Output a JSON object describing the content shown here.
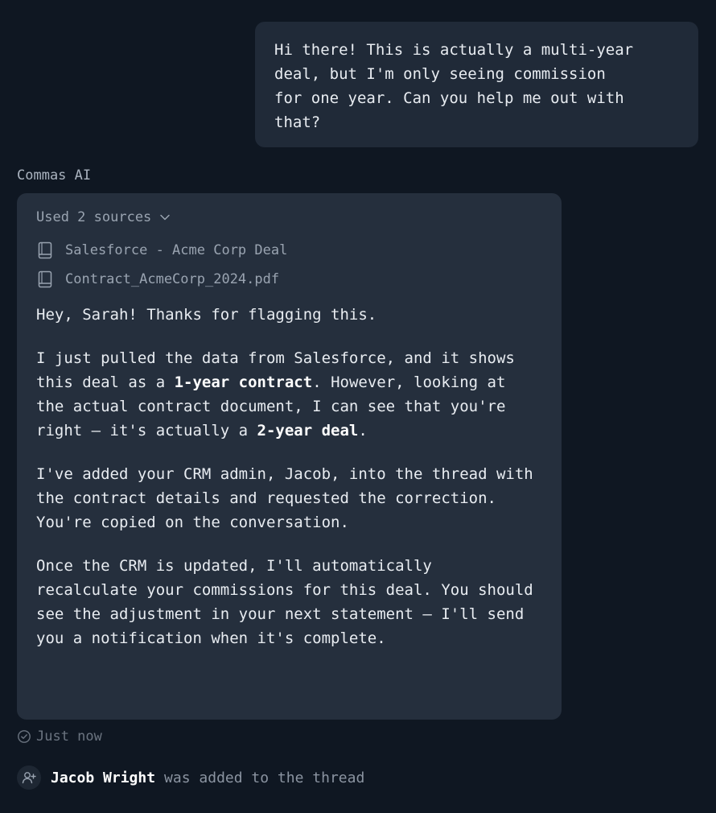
{
  "user_message": {
    "text": "Hi there! This is actually a multi-year\ndeal, but I'm only seeing commission\nfor one year. Can you help me out with\nthat?"
  },
  "assistant": {
    "name": "Commas AI",
    "sources_label": "Used 2 sources",
    "sources": [
      {
        "label": "Salesforce - Acme Corp Deal",
        "icon": "book-icon"
      },
      {
        "label": "Contract_AcmeCorp_2024.pdf",
        "icon": "book-icon"
      }
    ],
    "message": {
      "greeting": "Hey, Sarah! Thanks for flagging this.",
      "p2_a": "I just pulled the data from Salesforce, and it shows this deal as a ",
      "p2_b": "1-year contract",
      "p2_c": ". However, looking at the actual contract document, I can see that you're right — it's actually a ",
      "p2_d": "2-year deal",
      "p2_e": ".",
      "p3": "I've added your CRM admin, Jacob, into the thread with the contract details and requested the correction. You're copied on the conversation.",
      "p4": "Once the CRM is updated, I'll automatically recalculate your commissions for this deal. You should see the adjustment in your next statement — I'll send you a notification when it's complete."
    },
    "timestamp": "Just now"
  },
  "event": {
    "name": "Jacob Wright",
    "text": "was added to the thread",
    "icon": "user-plus-icon"
  }
}
